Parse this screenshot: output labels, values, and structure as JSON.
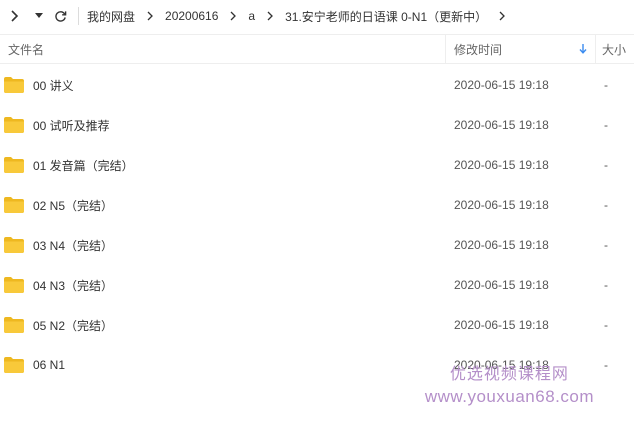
{
  "breadcrumb": [
    "我的网盘",
    "20200616",
    "a",
    "31.安宁老师的日语课 0-N1（更新中）"
  ],
  "header": {
    "name": "文件名",
    "time": "修改时间",
    "size": "大小"
  },
  "rows": [
    {
      "name": "00 讲义",
      "time": "2020-06-15 19:18",
      "size": "-"
    },
    {
      "name": "00 试听及推荐",
      "time": "2020-06-15 19:18",
      "size": "-"
    },
    {
      "name": "01 发音篇（完结）",
      "time": "2020-06-15 19:18",
      "size": "-"
    },
    {
      "name": "02 N5（完结）",
      "time": "2020-06-15 19:18",
      "size": "-"
    },
    {
      "name": "03 N4（完结）",
      "time": "2020-06-15 19:18",
      "size": "-"
    },
    {
      "name": "04 N3（完结）",
      "time": "2020-06-15 19:18",
      "size": "-"
    },
    {
      "name": "05 N2（完结）",
      "time": "2020-06-15 19:18",
      "size": "-"
    },
    {
      "name": "06 N1",
      "time": "2020-06-15 19:18",
      "size": "-"
    }
  ],
  "watermark": {
    "cn": "优选视频课程网",
    "url": "www.youxuan68.com"
  },
  "colors": {
    "folder": "#f8c93a",
    "folder_dark": "#eeb820",
    "sort_arrow": "#3b8cf0",
    "watermark": "#b48fc9"
  },
  "icons": {
    "forward": "chevron-right-icon",
    "dropdown": "caret-down-icon",
    "refresh": "refresh-icon",
    "sort": "arrow-down-icon",
    "folder": "folder-icon"
  }
}
